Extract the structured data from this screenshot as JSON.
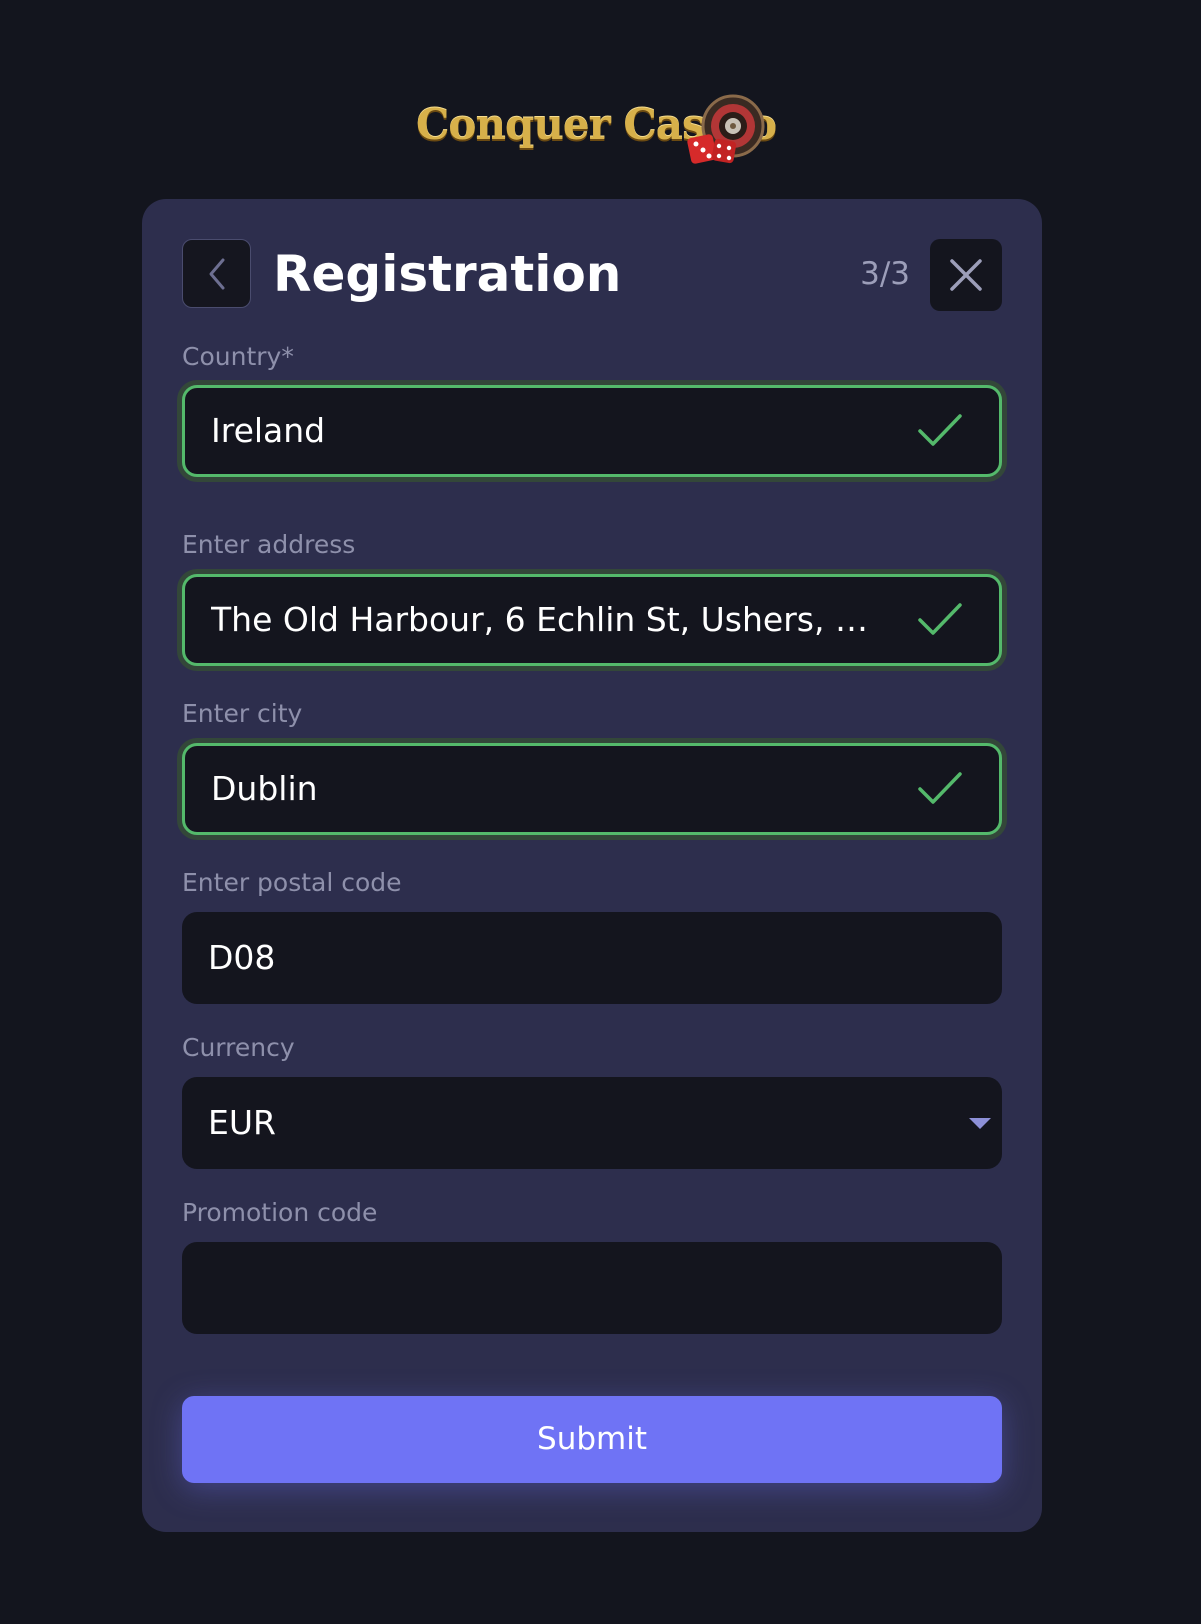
{
  "logo": {
    "text": "Conquer Casino"
  },
  "header": {
    "title": "Registration",
    "step": "3/3"
  },
  "form": {
    "country": {
      "label": "Country*",
      "value": "Ireland"
    },
    "address": {
      "label": "Enter address",
      "value": "The Old Harbour, 6 Echlin St, Ushers, Dub..."
    },
    "city": {
      "label": "Enter city",
      "value": "Dublin"
    },
    "postal": {
      "label": "Enter postal code",
      "value": "D08"
    },
    "currency": {
      "label": "Currency",
      "value": "EUR"
    },
    "promo": {
      "label": "Promotion code",
      "value": ""
    }
  },
  "submit_label": "Submit",
  "colors": {
    "background": "#13151e",
    "card": "#2d2e4d",
    "field": "#14151e",
    "valid": "#54b96b",
    "accent": "#6f73f5",
    "label": "#8e90ab"
  },
  "icons": [
    "back-chevron-icon",
    "close-icon",
    "checkmark-icon",
    "caret-down-icon",
    "roulette-wheel-icon",
    "dice-icon"
  ]
}
